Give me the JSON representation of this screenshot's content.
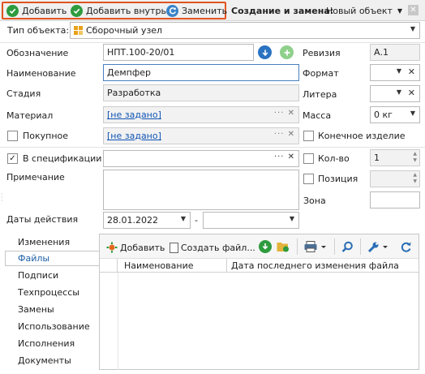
{
  "toolbar": {
    "add": "Добавить",
    "add_inside": "Добавить внутрь",
    "replace": "Заменить",
    "mode_label": "Создание и замена:",
    "mode_value": "Новый объект",
    "colors": {
      "highlight": "#e0541f",
      "green": "#2e9b3e"
    }
  },
  "object_type": {
    "label": "Тип объекта:",
    "value": "Сборочный узел"
  },
  "form": {
    "designation_label": "Обозначение",
    "designation_value": "НПТ.100-20/01",
    "revision_label": "Ревизия",
    "revision_value": "А.1",
    "name_label": "Наименование",
    "name_value": "Демпфер",
    "format_label": "Формат",
    "stage_label": "Стадия",
    "stage_value": "Разработка",
    "litera_label": "Литера",
    "material_label": "Материал",
    "material_value": "[не задано]",
    "mass_label": "Масса",
    "mass_value": "0 кг",
    "purchased_label": "Покупное",
    "purchased_value": "[не задано]",
    "final_product_label": "Конечное изделие",
    "in_spec_label": "В спецификации",
    "qty_label": "Кол-во",
    "qty_value": "1",
    "note_label": "Примечание",
    "position_label": "Позиция",
    "zone_label": "Зона",
    "dates_label": "Даты действия",
    "date_from": "28.01.2022",
    "date_sep": "-"
  },
  "nav": {
    "items": [
      "Изменения",
      "Файлы",
      "Подписи",
      "Техпроцессы",
      "Замены",
      "Использование",
      "Исполнения",
      "Документы"
    ],
    "selected": "Файлы"
  },
  "files_panel": {
    "add": "Добавить",
    "create_file": "Создать файл...",
    "columns": [
      "Наименование",
      "Дата последнего изменения файла"
    ]
  }
}
